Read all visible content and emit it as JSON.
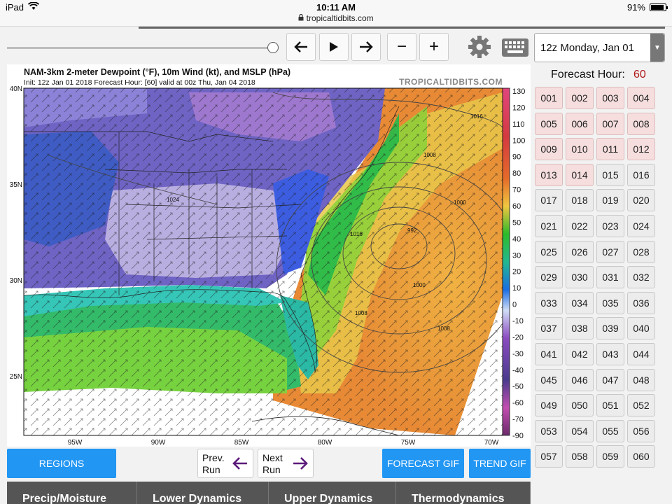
{
  "status_bar": {
    "device": "iPad",
    "time": "10:11 AM",
    "url": "tropicaltidbits.com",
    "battery_text": "91%",
    "battery_level": 0.91
  },
  "animation_slider_position": 1.0,
  "controls": {
    "prev_icon": "arrow-left-icon",
    "play_icon": "play-icon",
    "next_icon": "arrow-right-icon",
    "minus_label": "−",
    "plus_label": "+",
    "settings_icon": "gear-icon",
    "keyboard_icon": "keyboard-icon"
  },
  "run_select": {
    "selected": "12z Monday, Jan 01"
  },
  "map": {
    "title": "NAM-3km 2-meter Dewpoint (°F), 10m Wind (kt), and MSLP (hPa)",
    "subtitle": "Init: 12z Jan 01 2018   Forecast Hour: [60]   valid at 00z Thu, Jan 04 2018",
    "brand": "TROPICALTIDBITS.COM",
    "lat_labels": [
      "40N",
      "35N",
      "30N",
      "25N"
    ],
    "lon_labels": [
      "95W",
      "90W",
      "85W",
      "80W",
      "75W",
      "70W"
    ],
    "colorbar_ticks": [
      "130",
      "120",
      "110",
      "100",
      "90",
      "80",
      "70",
      "60",
      "50",
      "40",
      "30",
      "20",
      "10",
      "0",
      "-10",
      "-20",
      "-30",
      "-40",
      "-50",
      "-60",
      "-70",
      "-90"
    ],
    "isobar_labels": [
      "1016",
      "1008",
      "1000",
      "992",
      "1000",
      "1008",
      "1008",
      "1016",
      "1024"
    ],
    "low_pressure_label": "992"
  },
  "forecast_hour": {
    "label": "Forecast Hour:",
    "value": "60",
    "hours": [
      "001",
      "002",
      "003",
      "004",
      "005",
      "006",
      "007",
      "008",
      "009",
      "010",
      "011",
      "012",
      "013",
      "014",
      "015",
      "016",
      "017",
      "018",
      "019",
      "020",
      "021",
      "022",
      "023",
      "024",
      "025",
      "026",
      "027",
      "028",
      "029",
      "030",
      "031",
      "032",
      "033",
      "034",
      "035",
      "036",
      "037",
      "038",
      "039",
      "040",
      "041",
      "042",
      "043",
      "044",
      "045",
      "046",
      "047",
      "048",
      "049",
      "050",
      "051",
      "052",
      "053",
      "054",
      "055",
      "056",
      "057",
      "058",
      "059",
      "060"
    ],
    "loaded_hours": [
      "001",
      "002",
      "003",
      "004",
      "005",
      "006",
      "007",
      "008",
      "009",
      "010",
      "011",
      "012",
      "013",
      "014"
    ]
  },
  "buttons": {
    "regions": "REGIONS",
    "prev_run_line1": "Prev.",
    "prev_run_line2": "Run",
    "next_run_line1": "Next",
    "next_run_line2": "Run",
    "forecast_gif": "FORECAST GIF",
    "trend_gif": "TREND GIF"
  },
  "tabs": [
    "Precip/Moisture",
    "Lower Dynamics",
    "Upper Dynamics",
    "Thermodynamics"
  ],
  "colors": {
    "accent_blue": "#2196f3",
    "run_arrow": "#5a1a7a",
    "forecast_hour_value": "#b01818"
  }
}
